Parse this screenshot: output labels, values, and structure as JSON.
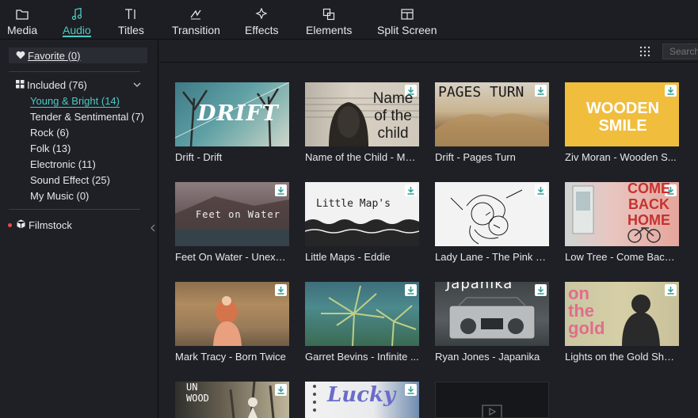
{
  "toolbar": {
    "tabs": [
      {
        "label": "Media",
        "icon": "folder-icon"
      },
      {
        "label": "Audio",
        "icon": "music-note-icon",
        "active": true
      },
      {
        "label": "Titles",
        "icon": "text-icon"
      },
      {
        "label": "Transition",
        "icon": "transition-icon"
      },
      {
        "label": "Effects",
        "icon": "sparkle-icon"
      },
      {
        "label": "Elements",
        "icon": "elements-icon"
      },
      {
        "label": "Split Screen",
        "icon": "split-screen-icon"
      }
    ],
    "accent": "#4ec9c1"
  },
  "sidebar": {
    "favorite": "Favorite (0)",
    "included": "Included (76)",
    "items": [
      "Young & Bright (14)",
      "Tender & Sentimental (7)",
      "Rock (6)",
      "Folk (13)",
      "Electronic (11)",
      "Sound Effect (25)",
      "My Music (0)"
    ],
    "filmstock": "Filmstock"
  },
  "search": {
    "placeholder": "Search"
  },
  "cards": [
    {
      "title": "Drift - Drift",
      "thumb_text": "DRIFT"
    },
    {
      "title": "Name of the Child - Mo...",
      "thumb_text": "Name of the child"
    },
    {
      "title": "Drift - Pages Turn",
      "thumb_text": "PAGES TURN"
    },
    {
      "title": "Ziv Moran - Wooden S...",
      "thumb_text": "WOODEN SMILE"
    },
    {
      "title": "Feet On Water - Unexp...",
      "thumb_text": "Feet on Water"
    },
    {
      "title": "Little Maps - Eddie",
      "thumb_text": "Little Map's"
    },
    {
      "title": "Lady Lane - The Pink E...",
      "thumb_text": ""
    },
    {
      "title": "Low Tree - Come Back ...",
      "thumb_text": "COME BACK HOME"
    },
    {
      "title": "Mark Tracy - Born Twice",
      "thumb_text": ""
    },
    {
      "title": "Garret Bevins - Infinite ...",
      "thumb_text": ""
    },
    {
      "title": "Ryan Jones - Japanika",
      "thumb_text": "Japanika"
    },
    {
      "title": "Lights on the Gold Shor...",
      "thumb_text": "on the gold"
    },
    {
      "title": "",
      "thumb_text": "UN WOOD"
    },
    {
      "title": "",
      "thumb_text": "Lucky"
    },
    {
      "title": "",
      "thumb_text": ""
    }
  ]
}
